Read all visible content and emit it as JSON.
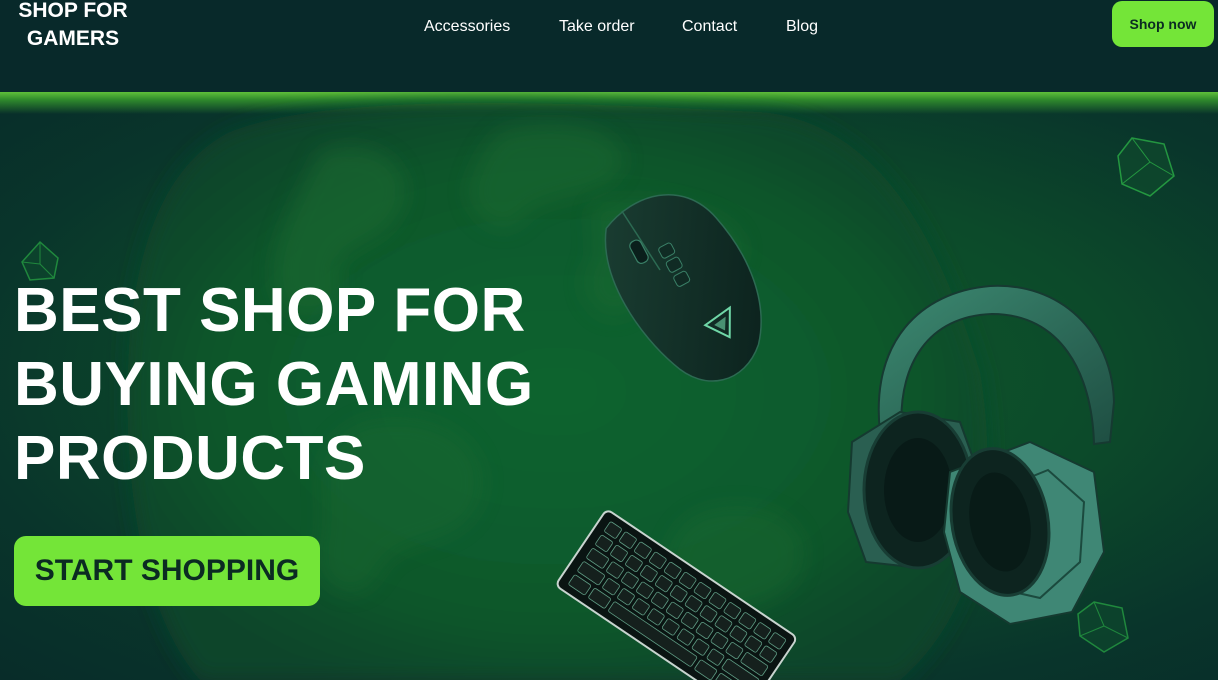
{
  "header": {
    "logo_line1": "SHOP FOR",
    "logo_line2": "GAMERS",
    "nav": [
      {
        "label": "Accessories"
      },
      {
        "label": "Take order"
      },
      {
        "label": "Contact"
      },
      {
        "label": "Blog"
      }
    ],
    "cta_label": "Shop now"
  },
  "hero": {
    "headline_lines": [
      "BEST SHOP FOR",
      "BUYING GAMING",
      "PRODUCTS"
    ],
    "cta_label": "START SHOPPING",
    "products": [
      "mouse-icon",
      "headphones-icon",
      "keyboard-icon"
    ],
    "decorations": [
      "gem-icon"
    ]
  },
  "colors": {
    "background": "#08292a",
    "hero_green": "#0c4a2a",
    "accent": "#74e538",
    "button_text": "#0b2b22",
    "text": "#ffffff"
  }
}
